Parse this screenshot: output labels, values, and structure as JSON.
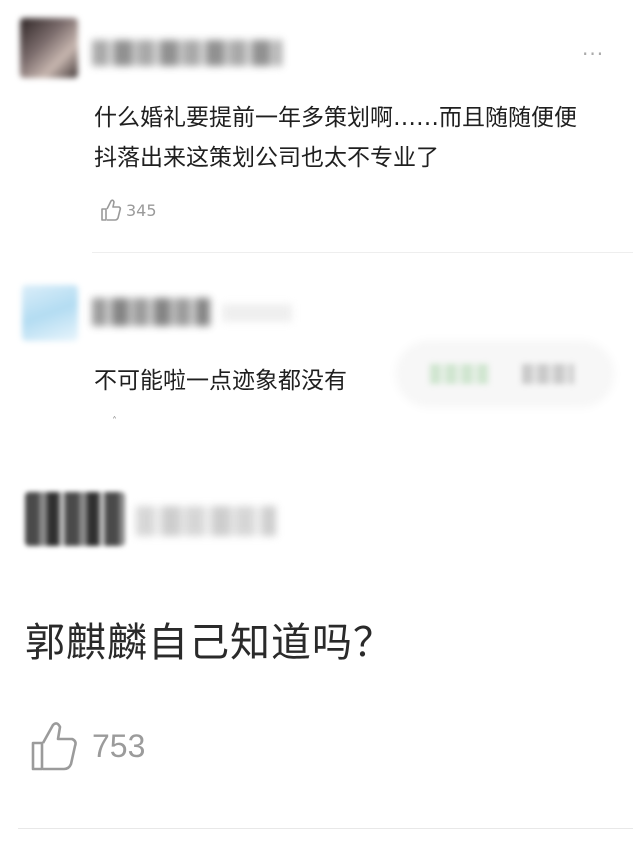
{
  "comments": [
    {
      "text": "什么婚礼要提前一年多策划啊……而且随随便便抖落出来这策划公司也太不专业了",
      "likes": "345"
    },
    {
      "text": "不可能啦一点迹象都没有"
    },
    {
      "text": "郭麒麟自己知道吗？",
      "likes": "753"
    }
  ],
  "icons": {
    "more": "more-icon",
    "like": "thumbs-up-icon"
  },
  "colors": {
    "text": "#1f1f1f",
    "muted": "#9a9a9a",
    "divider": "#eeeeee"
  }
}
